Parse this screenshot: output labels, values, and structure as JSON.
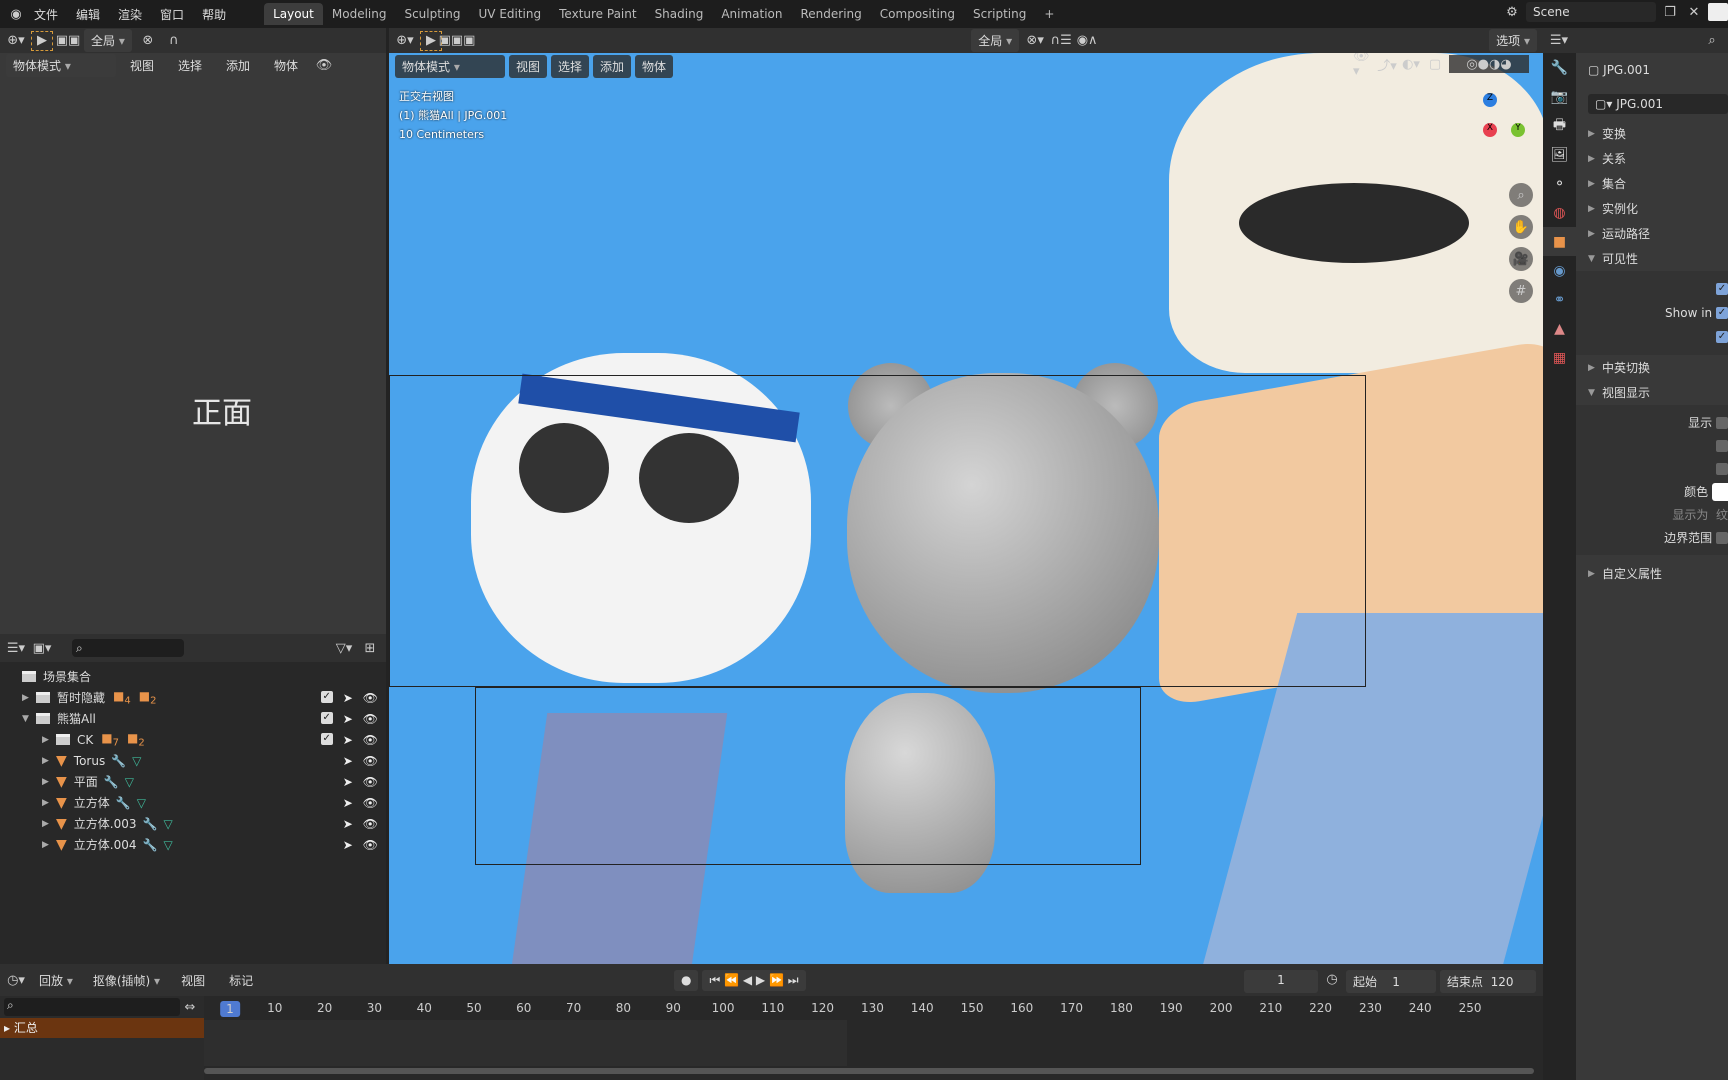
{
  "menubar": {
    "items": [
      "文件",
      "编辑",
      "渲染",
      "窗口",
      "帮助"
    ],
    "workspaces": [
      "Layout",
      "Modeling",
      "Sculpting",
      "UV Editing",
      "Texture Paint",
      "Shading",
      "Animation",
      "Rendering",
      "Compositing",
      "Scripting"
    ],
    "active_workspace": "Layout",
    "add_tab": "+",
    "scene": "Scene"
  },
  "left_viewport": {
    "transform_orientation": "全局",
    "mode": "物体模式",
    "menus": [
      "视图",
      "选择",
      "添加",
      "物体"
    ],
    "view_label": "正面"
  },
  "main_viewport": {
    "transform_orientation": "全局",
    "options": "选项",
    "mode": "物体模式",
    "menus": [
      "视图",
      "选择",
      "添加",
      "物体"
    ],
    "overlay": {
      "view_name": "正交右视图",
      "object": "(1) 熊猫All | JPG.001",
      "scale": "10 Centimeters"
    },
    "background_color": "#4aa3ec"
  },
  "outliner": {
    "search_placeholder": "",
    "root": "场景集合",
    "rows": [
      {
        "name": "暂时隐藏",
        "level": 1,
        "expanded": false,
        "type": "collection",
        "badges": [
          "4",
          "2"
        ]
      },
      {
        "name": "熊猫All",
        "level": 1,
        "expanded": true,
        "type": "collection"
      },
      {
        "name": "CK",
        "level": 2,
        "expanded": false,
        "type": "collection",
        "badges": [
          "7",
          "2"
        ]
      },
      {
        "name": "Torus",
        "level": 2,
        "expanded": false,
        "type": "mesh"
      },
      {
        "name": "平面",
        "level": 2,
        "expanded": false,
        "type": "mesh"
      },
      {
        "name": "立方体",
        "level": 2,
        "expanded": false,
        "type": "mesh"
      },
      {
        "name": "立方体.003",
        "level": 2,
        "expanded": false,
        "type": "mesh"
      },
      {
        "name": "立方体.004",
        "level": 2,
        "expanded": false,
        "type": "mesh"
      }
    ]
  },
  "properties": {
    "object_name": "JPG.001",
    "data_name": "JPG.001",
    "sections": {
      "transform": "变换",
      "relations": "关系",
      "collections": "集合",
      "instancing": "实例化",
      "motion_paths": "运动路径",
      "visibility": "可见性",
      "cn_en": "中英切换",
      "viewport_display": "视图显示",
      "custom_props": "自定义属性"
    },
    "show_in": "Show in",
    "display": "显示",
    "color": "颜色",
    "display_as": "显示为",
    "display_as_value": "纹",
    "bounds": "边界范围"
  },
  "timeline": {
    "playback": "回放",
    "keying": "抠像(插帧)",
    "menus": [
      "视图",
      "标记"
    ],
    "current_frame": "1",
    "start_label": "起始",
    "start": "1",
    "end_label": "结束点",
    "end": "120",
    "summary": "汇总",
    "ticks": [
      "1",
      "10",
      "20",
      "30",
      "40",
      "50",
      "60",
      "70",
      "80",
      "90",
      "100",
      "110",
      "120",
      "130",
      "140",
      "150",
      "160",
      "170",
      "180",
      "190",
      "200",
      "210",
      "220",
      "230",
      "240",
      "250"
    ]
  }
}
